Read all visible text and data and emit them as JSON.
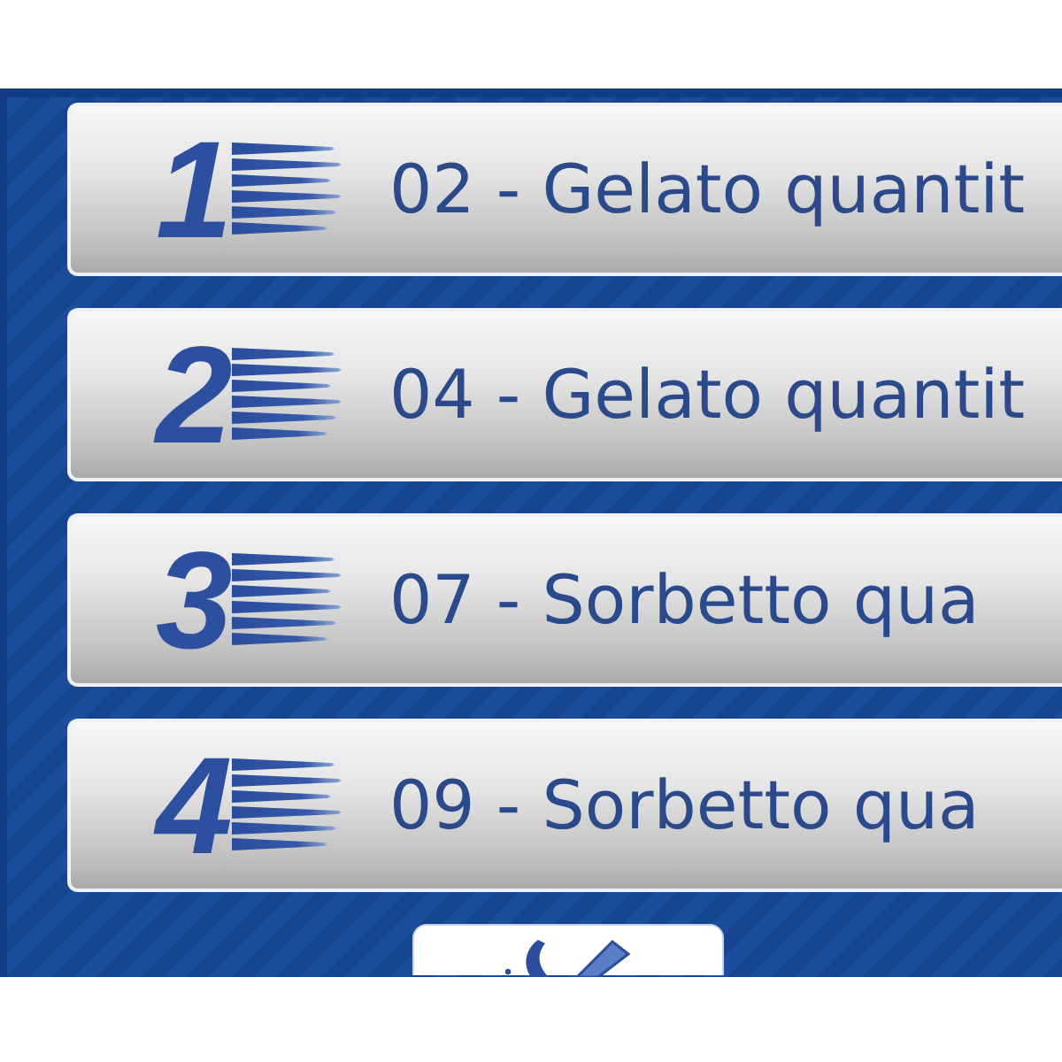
{
  "presets": [
    {
      "number": "1",
      "label": "02 - Gelato quantit"
    },
    {
      "number": "2",
      "label": "04 - Gelato quantit"
    },
    {
      "number": "3",
      "label": "07 - Sorbetto qua"
    },
    {
      "number": "4",
      "label": "09 - Sorbetto qua"
    }
  ]
}
